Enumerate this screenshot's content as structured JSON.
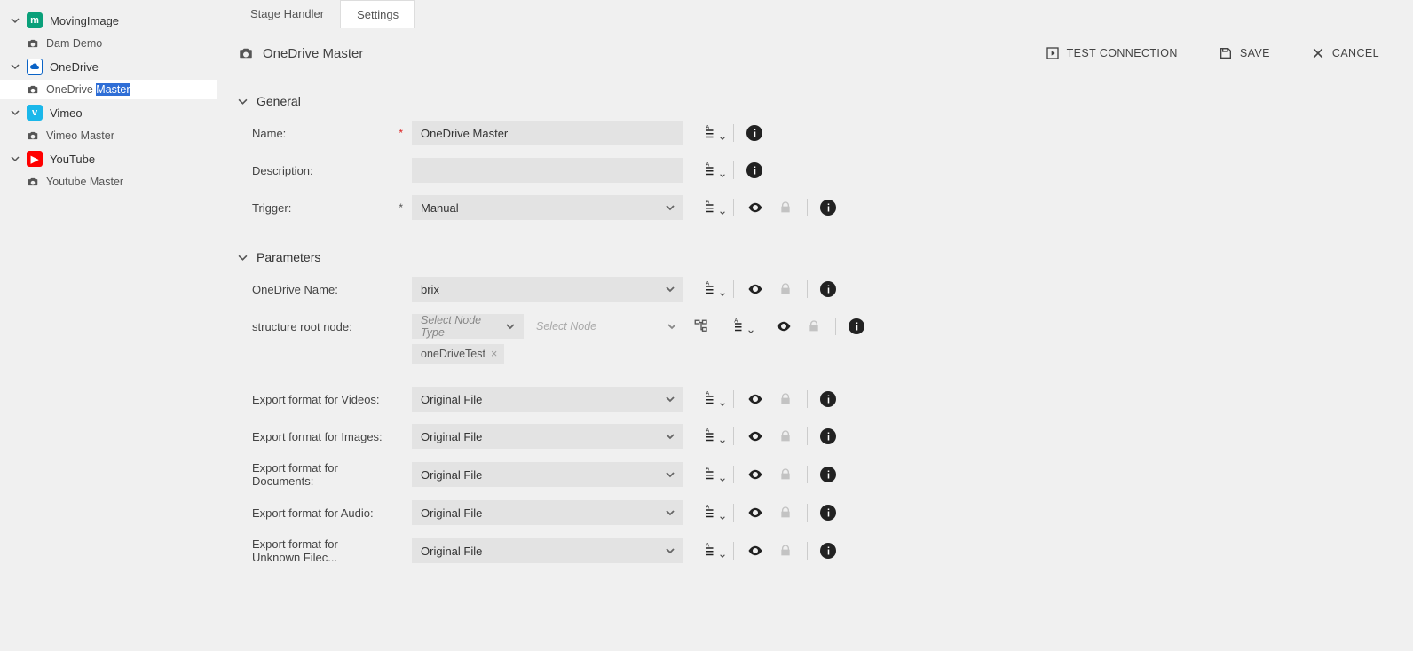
{
  "sidebar": {
    "groups": [
      {
        "label": "MovingImage",
        "child": "Dam Demo"
      },
      {
        "label": "OneDrive",
        "child_prefix": "OneDrive ",
        "child_highlight": "Master",
        "selected": true
      },
      {
        "label": "Vimeo",
        "child": "Vimeo Master"
      },
      {
        "label": "YouTube",
        "child": "Youtube Master"
      }
    ]
  },
  "tabs": [
    {
      "label": "Stage Handler",
      "active": false
    },
    {
      "label": "Settings",
      "active": true
    }
  ],
  "toolbar": {
    "title": "OneDrive Master",
    "test_connection": "TEST CONNECTION",
    "save": "SAVE",
    "cancel": "CANCEL"
  },
  "sections": {
    "general": {
      "title": "General",
      "rows": {
        "name": {
          "label": "Name:",
          "value": "OneDrive Master",
          "required": true,
          "icons": "lang+info"
        },
        "description": {
          "label": "Description:",
          "value": "",
          "icons": "lang+info"
        },
        "trigger": {
          "label": "Trigger:",
          "value": "Manual",
          "inherited": true,
          "icons": "lang+eye+lock+info",
          "select": true
        }
      }
    },
    "parameters": {
      "title": "Parameters",
      "rows": {
        "onedrive_name": {
          "label": "OneDrive Name:",
          "value": "brix",
          "select": true,
          "icons": "lang+eye+lock+info"
        },
        "root_node": {
          "label": "structure root node:",
          "node_type_placeholder": "Select Node Type",
          "node_placeholder": "Select Node",
          "chip": "oneDriveTest",
          "icons": "lang+eye+lock+info"
        },
        "fmt_videos": {
          "label": "Export format for Videos:",
          "value": "Original File",
          "select": true,
          "icons": "lang+eye+lock+info"
        },
        "fmt_images": {
          "label": "Export format for Images:",
          "value": "Original File",
          "select": true,
          "icons": "lang+eye+lock+info"
        },
        "fmt_docs": {
          "label": "Export format for Documents:",
          "value": "Original File",
          "select": true,
          "icons": "lang+eye+lock+info"
        },
        "fmt_audio": {
          "label": "Export format for Audio:",
          "value": "Original File",
          "select": true,
          "icons": "lang+eye+lock+info"
        },
        "fmt_unknown": {
          "label": "Export format for Unknown Filec...",
          "value": "Original File",
          "select": true,
          "icons": "lang+eye+lock+info"
        }
      }
    }
  }
}
